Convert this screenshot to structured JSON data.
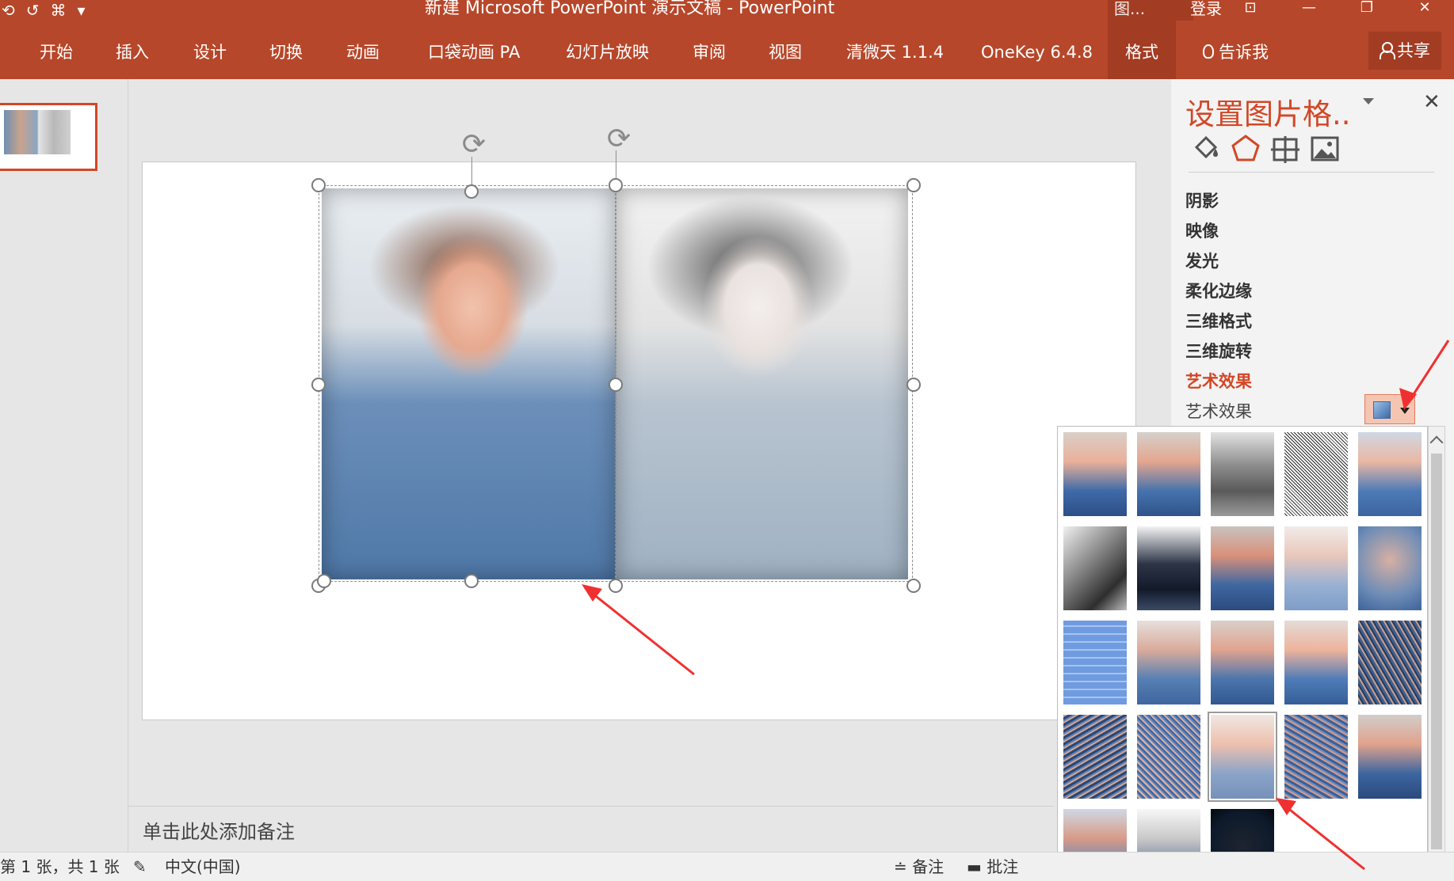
{
  "titlebar": {
    "title": "新建 Microsoft PowerPoint 演示文稿  -  PowerPoint",
    "context_group": "图...",
    "login": "登录",
    "qat": [
      "⟲",
      "↺",
      "⌘",
      "▾"
    ]
  },
  "window_buttons": [
    "⊡",
    "—",
    "❐",
    "✕"
  ],
  "ribbon": {
    "tabs": [
      "开始",
      "插入",
      "设计",
      "切换",
      "动画",
      "口袋动画 PA",
      "幻灯片放映",
      "审阅",
      "视图",
      "清微天 1.1.4",
      "OneKey 6.4.8",
      "格式"
    ],
    "active_tab": "格式",
    "tell_me": "告诉我",
    "share": "共享"
  },
  "format_pane": {
    "title": "设置图片格..",
    "close": "✕",
    "icons": [
      "fill-line-icon",
      "effects-icon",
      "size-position-icon",
      "picture-icon"
    ],
    "sections": [
      "阴影",
      "映像",
      "发光",
      "柔化边缘",
      "三维格式",
      "三维旋转",
      "艺术效果"
    ],
    "active_section": "艺术效果",
    "art_effects_label": "艺术效果"
  },
  "gallery": {
    "selected_index": 17,
    "effects": [
      {
        "bg": "linear-gradient(180deg,#d9cfc8 0%,#e9b19a 35%,#3f6aa8 70%,#2d4f86 100%)"
      },
      {
        "bg": "linear-gradient(180deg,#d5d0cc 0%,#e4a68e 35%,#4673ad 70%,#2f538a 100%)"
      },
      {
        "bg": "linear-gradient(180deg,#e2e2e2 0%,#8c8c8c 40%,#5a5a5a 70%,#9a9a9a 100%)"
      },
      {
        "bg": "repeating-linear-gradient(45deg,#ffffff 0 2px,#2a2a2a 2px 3px)"
      },
      {
        "bg": "linear-gradient(180deg,#cfd7e3 0%,#eab8a3 35%,#4d7bb7 70%,#3b64a0 100%)"
      },
      {
        "bg": "linear-gradient(135deg,#f0f0f0 0%,#7d7d7d 45%,#2e2e2e 75%,#bdbdbd 100%)"
      },
      {
        "bg": "linear-gradient(180deg,#f3f3f3 0%,#2c3446 45%,#121a2a 75%,#3b4a66 100%)"
      },
      {
        "bg": "linear-gradient(180deg,#c9c2bd 0%,#d9907a 35%,#3e67a1 70%,#2c4b7e 100%)"
      },
      {
        "bg": "linear-gradient(180deg,#f1ebe8 0%,#e9c7bb 35%,#98b1d2 70%,#7f9dc8 100%)"
      },
      {
        "bg": "radial-gradient(circle at 50% 40%,#d7b0a3 0%,#6f8db6 60%,#3d639b 100%)"
      },
      {
        "bg": "repeating-linear-gradient(0deg,#6f9be0 0 8px,#a7c4ef 8px 10px),linear-gradient(#e5a691,#4b7bc5)"
      },
      {
        "bg": "linear-gradient(180deg,#e6e0dd 0%,#d9ab9b 35%,#567fb3 70%,#3f66a0 100%)"
      },
      {
        "bg": "linear-gradient(180deg,#d7d0ca 0%,#e1a38e 35%,#4a75ad 70%,#32578f 100%)"
      },
      {
        "bg": "linear-gradient(180deg,#e3dcd8 0%,#eeb39c 35%,#4e7cb8 70%,#355e98 100%)"
      },
      {
        "bg": "repeating-linear-gradient(60deg,#3f5f8f 0 3px,#c9a08e 3px 5px,#223a60 5px 7px)"
      },
      {
        "bg": "repeating-linear-gradient(-30deg,#2b4672 0 3px,#d2a593 3px 5px,#5b7fb5 5px 7px)"
      },
      {
        "bg": "repeating-linear-gradient(45deg,#3e64a0 0 2px,#e1b3a2 2px 4px,#5f86bf 4px 6px)"
      },
      {
        "bg": "linear-gradient(180deg,#efe7e3 0%,#eec0ad 35%,#8aa4c8 70%,#7691b9 100%)"
      },
      {
        "bg": "repeating-linear-gradient(30deg,#3a5f98 0 3px,#d89a86 3px 5px,#6b8fc4 5px 7px)"
      },
      {
        "bg": "linear-gradient(180deg,#d1cdca 0%,#e1a28c 35%,#3d66a0 70%,#2a4a7d 100%)"
      },
      {
        "bg": "linear-gradient(180deg,#cfd8e6 0%,#d89b86 35%,#5b86c2 70%,#4a75b2 100%)"
      },
      {
        "bg": "linear-gradient(180deg,#f7f7f7 0%,#c9c9c9 35%,#6d7f98 70%,#4e6484 100%)"
      },
      {
        "bg": "radial-gradient(circle at 50% 45%,#1e2430 0%,#0d1a2b 60%,#000000 100%)"
      }
    ]
  },
  "notes": {
    "placeholder": "单击此处添加备注"
  },
  "status": {
    "slide": "第 1 张，共 1 张",
    "language": "中文(中国)",
    "notes_btn": "备注",
    "comments_btn": "批注"
  }
}
